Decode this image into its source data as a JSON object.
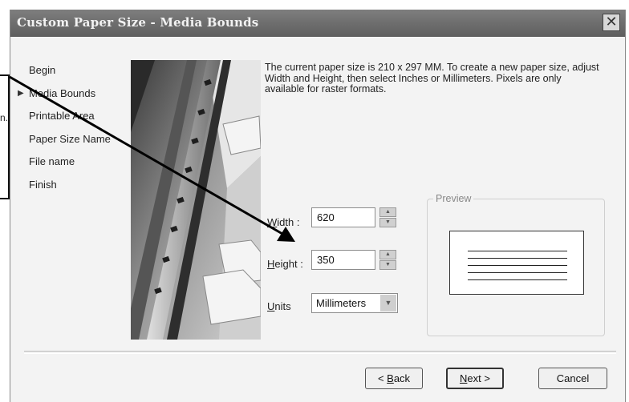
{
  "window": {
    "title": "Custom Paper Size - Media Bounds",
    "close_glyph": "✕"
  },
  "steps": [
    {
      "label": "Begin",
      "current": false
    },
    {
      "label": "Media Bounds",
      "current": true
    },
    {
      "label": "Printable Area",
      "current": false
    },
    {
      "label": "Paper Size Name",
      "current": false
    },
    {
      "label": "File name",
      "current": false
    },
    {
      "label": "Finish",
      "current": false
    }
  ],
  "description": "The current paper size is 210 x 297 MM. To create a new paper size, adjust Width and Height, then select Inches or Millimeters. Pixels are only available for raster formats.",
  "width": {
    "label_mnemonic": "W",
    "label_rest": "idth :",
    "value": "620"
  },
  "height": {
    "label_mnemonic": "H",
    "label_rest": "eight :",
    "value": "350"
  },
  "units": {
    "label_mnemonic": "U",
    "label_rest": "nits",
    "selected": "Millimeters"
  },
  "preview": {
    "title": "Preview"
  },
  "buttons": {
    "back": {
      "arrow": "<",
      "mnemonic": "B",
      "rest": "ack"
    },
    "next": {
      "mnemonic": "N",
      "rest": "ext",
      "arrow": ">"
    },
    "cancel": "Cancel"
  },
  "outside_text": "n.",
  "icons": {
    "spin_up": "spin-up-icon",
    "spin_down": "spin-down-icon",
    "dropdown": "chevron-down-icon",
    "current_step": "arrow-right-icon"
  }
}
